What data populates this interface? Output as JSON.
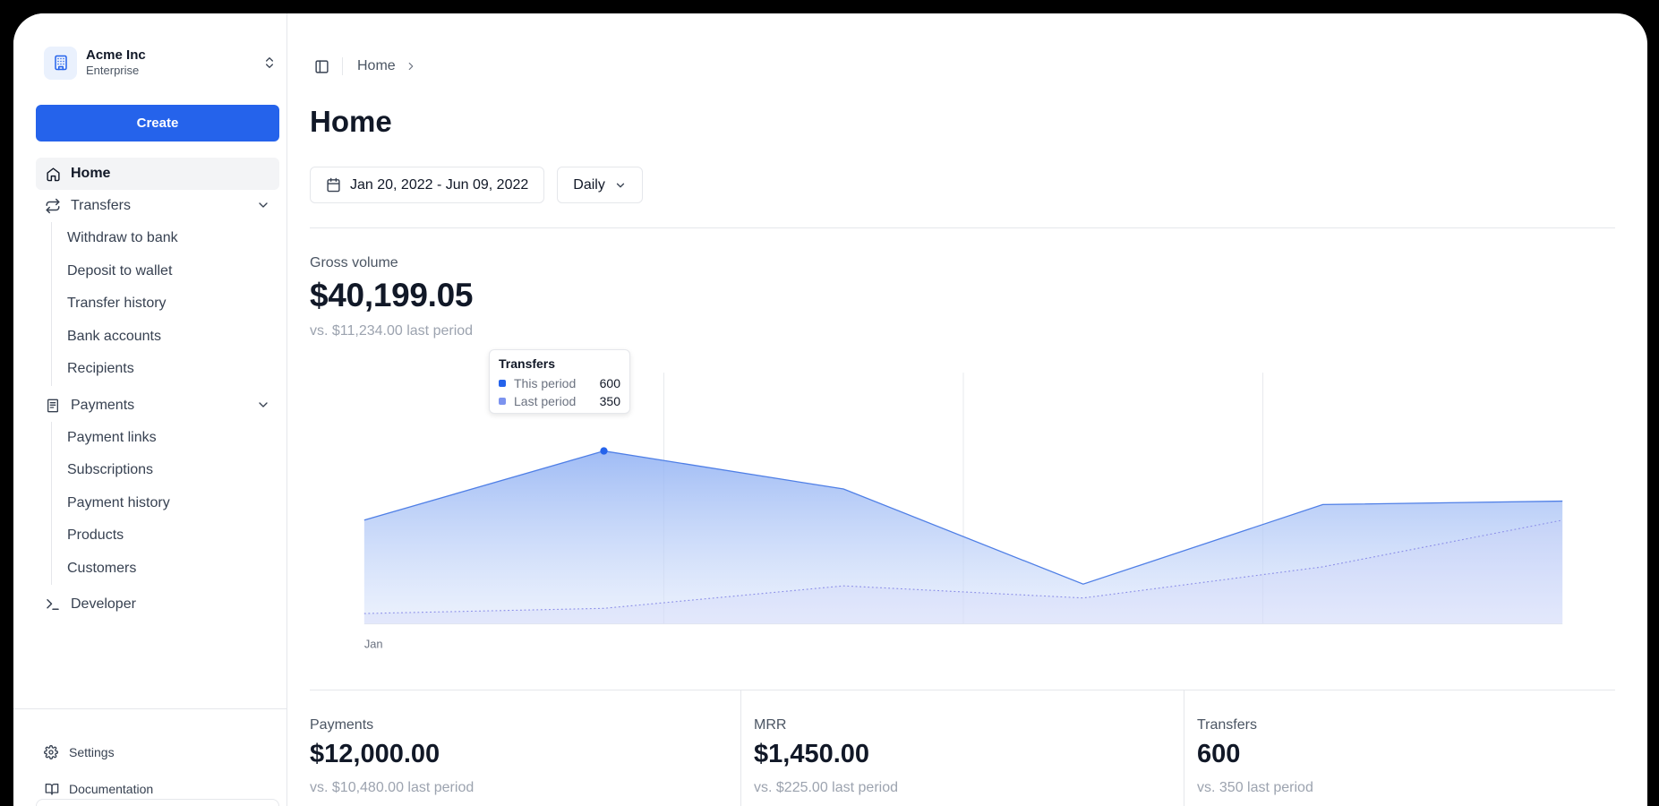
{
  "org": {
    "name": "Acme Inc",
    "plan": "Enterprise"
  },
  "sidebar": {
    "create_label": "Create",
    "home_label": "Home",
    "transfers": {
      "label": "Transfers",
      "items": [
        "Withdraw to bank",
        "Deposit to wallet",
        "Transfer history",
        "Bank accounts",
        "Recipients"
      ]
    },
    "payments": {
      "label": "Payments",
      "items": [
        "Payment links",
        "Subscriptions",
        "Payment history",
        "Products",
        "Customers"
      ]
    },
    "developer_label": "Developer",
    "footer": {
      "settings": "Settings",
      "documentation": "Documentation"
    }
  },
  "breadcrumb": {
    "home": "Home"
  },
  "page": {
    "title": "Home",
    "date_range": "Jan 20, 2022 - Jun 09, 2022",
    "interval": "Daily"
  },
  "gross": {
    "label": "Gross volume",
    "value": "$40,199.05",
    "compare": "vs. $11,234.00 last period"
  },
  "tooltip": {
    "title": "Transfers",
    "rows": [
      {
        "label": "This period",
        "value": "600",
        "color": "#2563eb"
      },
      {
        "label": "Last period",
        "value": "350",
        "color": "#7c93ef"
      }
    ]
  },
  "chart_data": {
    "type": "area",
    "x_tick_label": "Jan",
    "series": [
      {
        "name": "This period",
        "values": [
          560,
          600,
          578,
          523,
          569,
          571
        ],
        "color": "#4f7fe6"
      },
      {
        "name": "Last period",
        "values": [
          506,
          509,
          522,
          515,
          533,
          560
        ],
        "color": "#8b8ee8"
      }
    ],
    "ylim": [
      500,
      650
    ],
    "highlight_index": 1,
    "gridlines_vertical": 3
  },
  "metrics": [
    {
      "label": "Payments",
      "value": "$12,000.00",
      "compare": "vs. $10,480.00 last period"
    },
    {
      "label": "MRR",
      "value": "$1,450.00",
      "compare": "vs. $225.00 last period"
    },
    {
      "label": "Transfers",
      "value": "600",
      "compare": "vs. 350 last period"
    }
  ],
  "colors": {
    "accent": "#2563eb"
  }
}
